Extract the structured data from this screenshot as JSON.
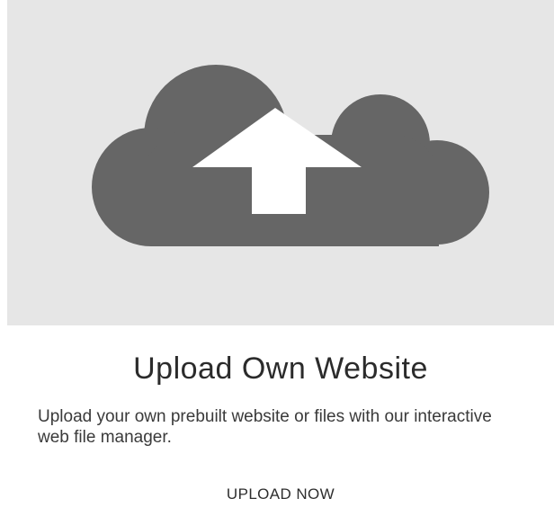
{
  "card": {
    "icon": "cloud-upload-icon",
    "icon_color": "#666666",
    "media_background": "#e6e6e6",
    "title": "Upload Own Website",
    "description": "Upload your own prebuilt website or files with our interactive web file manager.",
    "action_label": "UPLOAD NOW"
  }
}
